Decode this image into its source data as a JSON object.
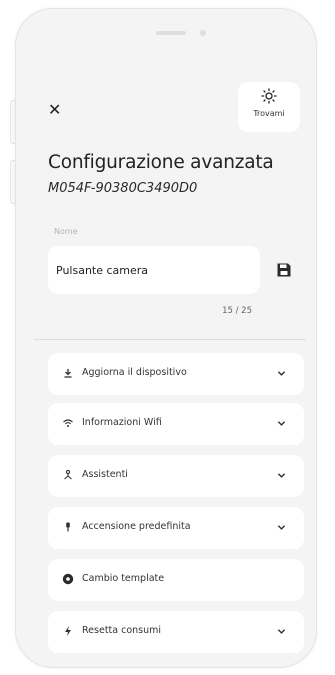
{
  "header": {
    "close_label": "✕",
    "find_label": "Trovami"
  },
  "title": "Configurazione avanzata",
  "serial": "M054F-90380C3490D0",
  "name_field": {
    "label": "Nome",
    "value": "Pulsante camera",
    "counter": "15 / 25"
  },
  "menu": {
    "items": [
      {
        "label": "Aggiorna il dispositivo",
        "icon": "download-icon",
        "expandable": true
      },
      {
        "label": "Informazioni Wifi",
        "icon": "wifi-icon",
        "expandable": true
      },
      {
        "label": "Assistenti",
        "icon": "assistant-icon",
        "expandable": true
      },
      {
        "label": "Accensione predefinita",
        "icon": "power-default-icon",
        "expandable": true
      },
      {
        "label": "Cambio template",
        "icon": "template-icon",
        "expandable": false
      },
      {
        "label": "Resetta consumi",
        "icon": "lightning-icon",
        "expandable": true
      }
    ]
  }
}
